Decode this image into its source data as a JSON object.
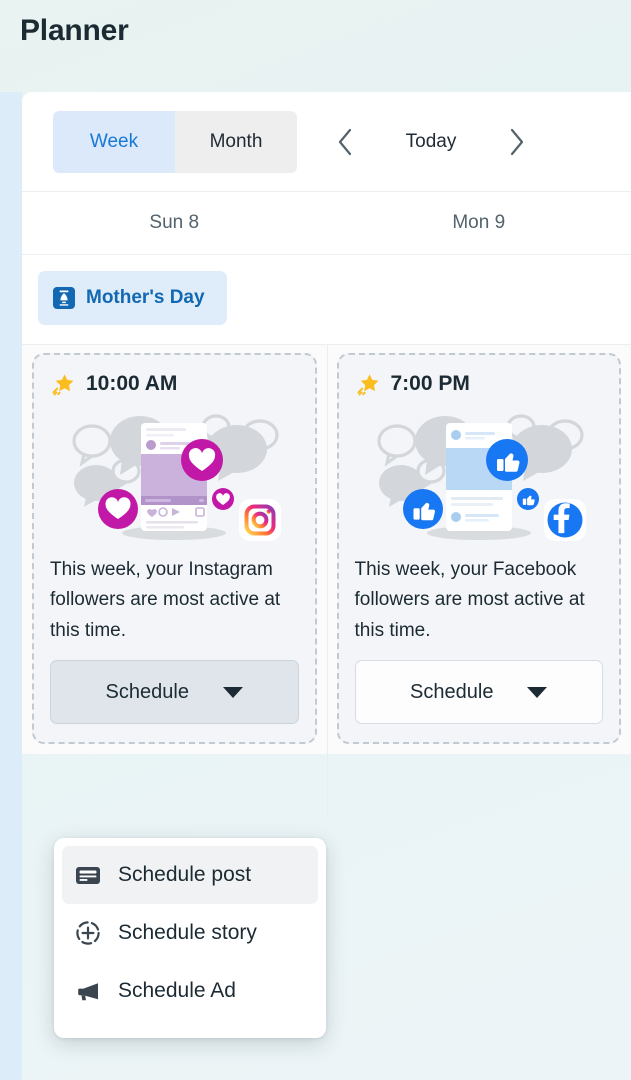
{
  "header": {
    "title": "Planner"
  },
  "toolbar": {
    "view_tabs": [
      {
        "label": "Week",
        "active": true
      },
      {
        "label": "Month",
        "active": false
      }
    ],
    "prev_icon": "chevron-left-icon",
    "today_label": "Today",
    "next_icon": "chevron-right-icon"
  },
  "calendar": {
    "day_headers": [
      "Sun 8",
      "Mon 9"
    ],
    "all_day_events": [
      {
        "label": "Mother's Day",
        "icon": "holiday-flower-icon",
        "color": "#1268b3",
        "background": "#dfecf9",
        "column": 0
      }
    ],
    "suggestions": [
      {
        "icon": "star-icon",
        "time": "10:00 AM",
        "network": "instagram",
        "illustration": "instagram-engagement-illustration",
        "description": "This week, your Instagram followers are most active at this time.",
        "button_label": "Schedule",
        "button_caret": "caret-down-icon",
        "button_pressed": true
      },
      {
        "icon": "star-icon",
        "time": "7:00 PM",
        "network": "facebook",
        "illustration": "facebook-engagement-illustration",
        "description": "This week, your Facebook followers are most active at this time.",
        "button_label": "Schedule",
        "button_caret": "caret-down-icon",
        "button_pressed": false
      }
    ]
  },
  "dropdown": {
    "open": true,
    "items": [
      {
        "label": "Schedule post",
        "icon": "post-card-icon",
        "highlighted": true
      },
      {
        "label": "Schedule story",
        "icon": "story-plus-icon",
        "highlighted": false
      },
      {
        "label": "Schedule Ad",
        "icon": "megaphone-icon",
        "highlighted": false
      }
    ]
  },
  "colors": {
    "accent_blue": "#1878d4",
    "holiday_blue": "#1268b3",
    "instagram_magenta": "#c218a8",
    "facebook_blue": "#1877f2",
    "star_yellow": "#fbbc1e",
    "page_background": "#e9f3f1"
  }
}
